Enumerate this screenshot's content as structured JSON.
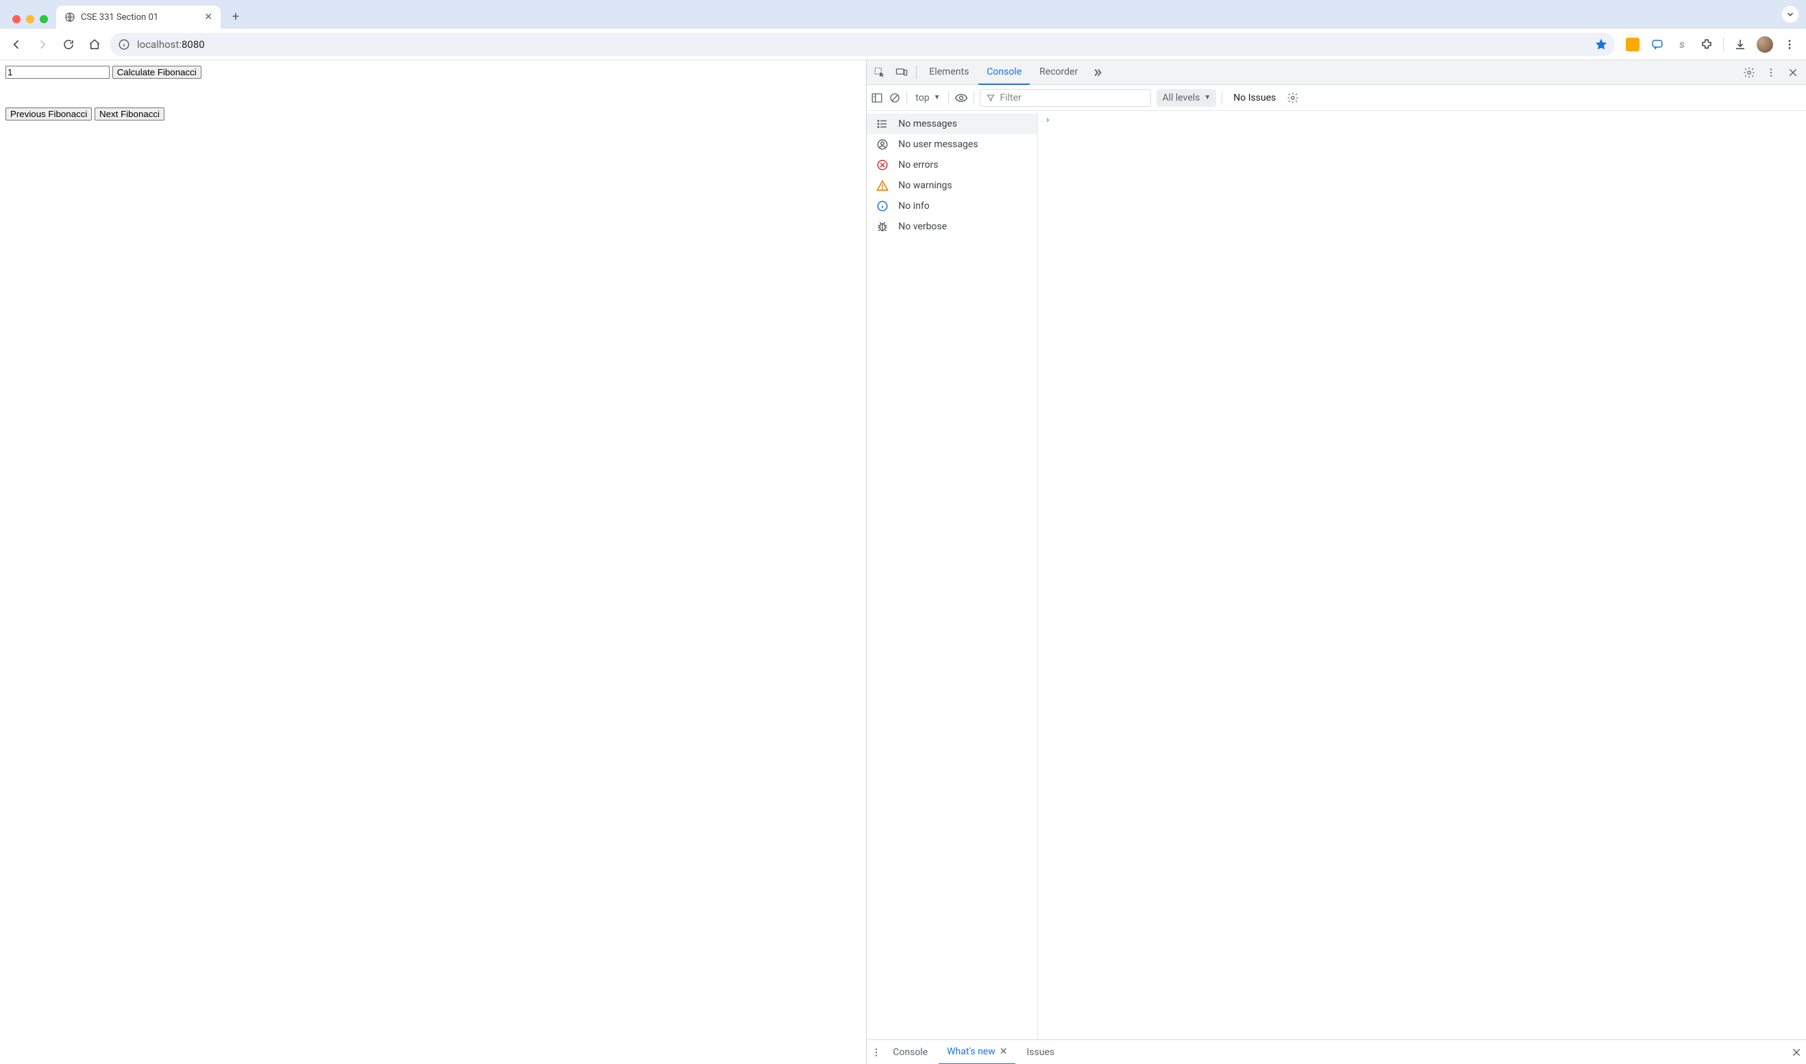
{
  "browser": {
    "tab_title": "CSE 331 Section 01",
    "url_prefix": "localhost:",
    "url_suffix": "8080"
  },
  "page": {
    "input_value": "1",
    "calc_button": "Calculate Fibonacci",
    "prev_button": "Previous Fibonacci",
    "next_button": "Next Fibonacci"
  },
  "devtools": {
    "tabs": {
      "elements": "Elements",
      "console": "Console",
      "recorder": "Recorder"
    },
    "console_toolbar": {
      "scope": "top",
      "filter_placeholder": "Filter",
      "levels_label": "All levels",
      "no_issues": "No Issues"
    },
    "sidebar": {
      "messages": "No messages",
      "user_messages": "No user messages",
      "errors": "No errors",
      "warnings": "No warnings",
      "info": "No info",
      "verbose": "No verbose"
    },
    "drawer": {
      "console": "Console",
      "whatsnew": "What's new",
      "issues": "Issues"
    }
  }
}
